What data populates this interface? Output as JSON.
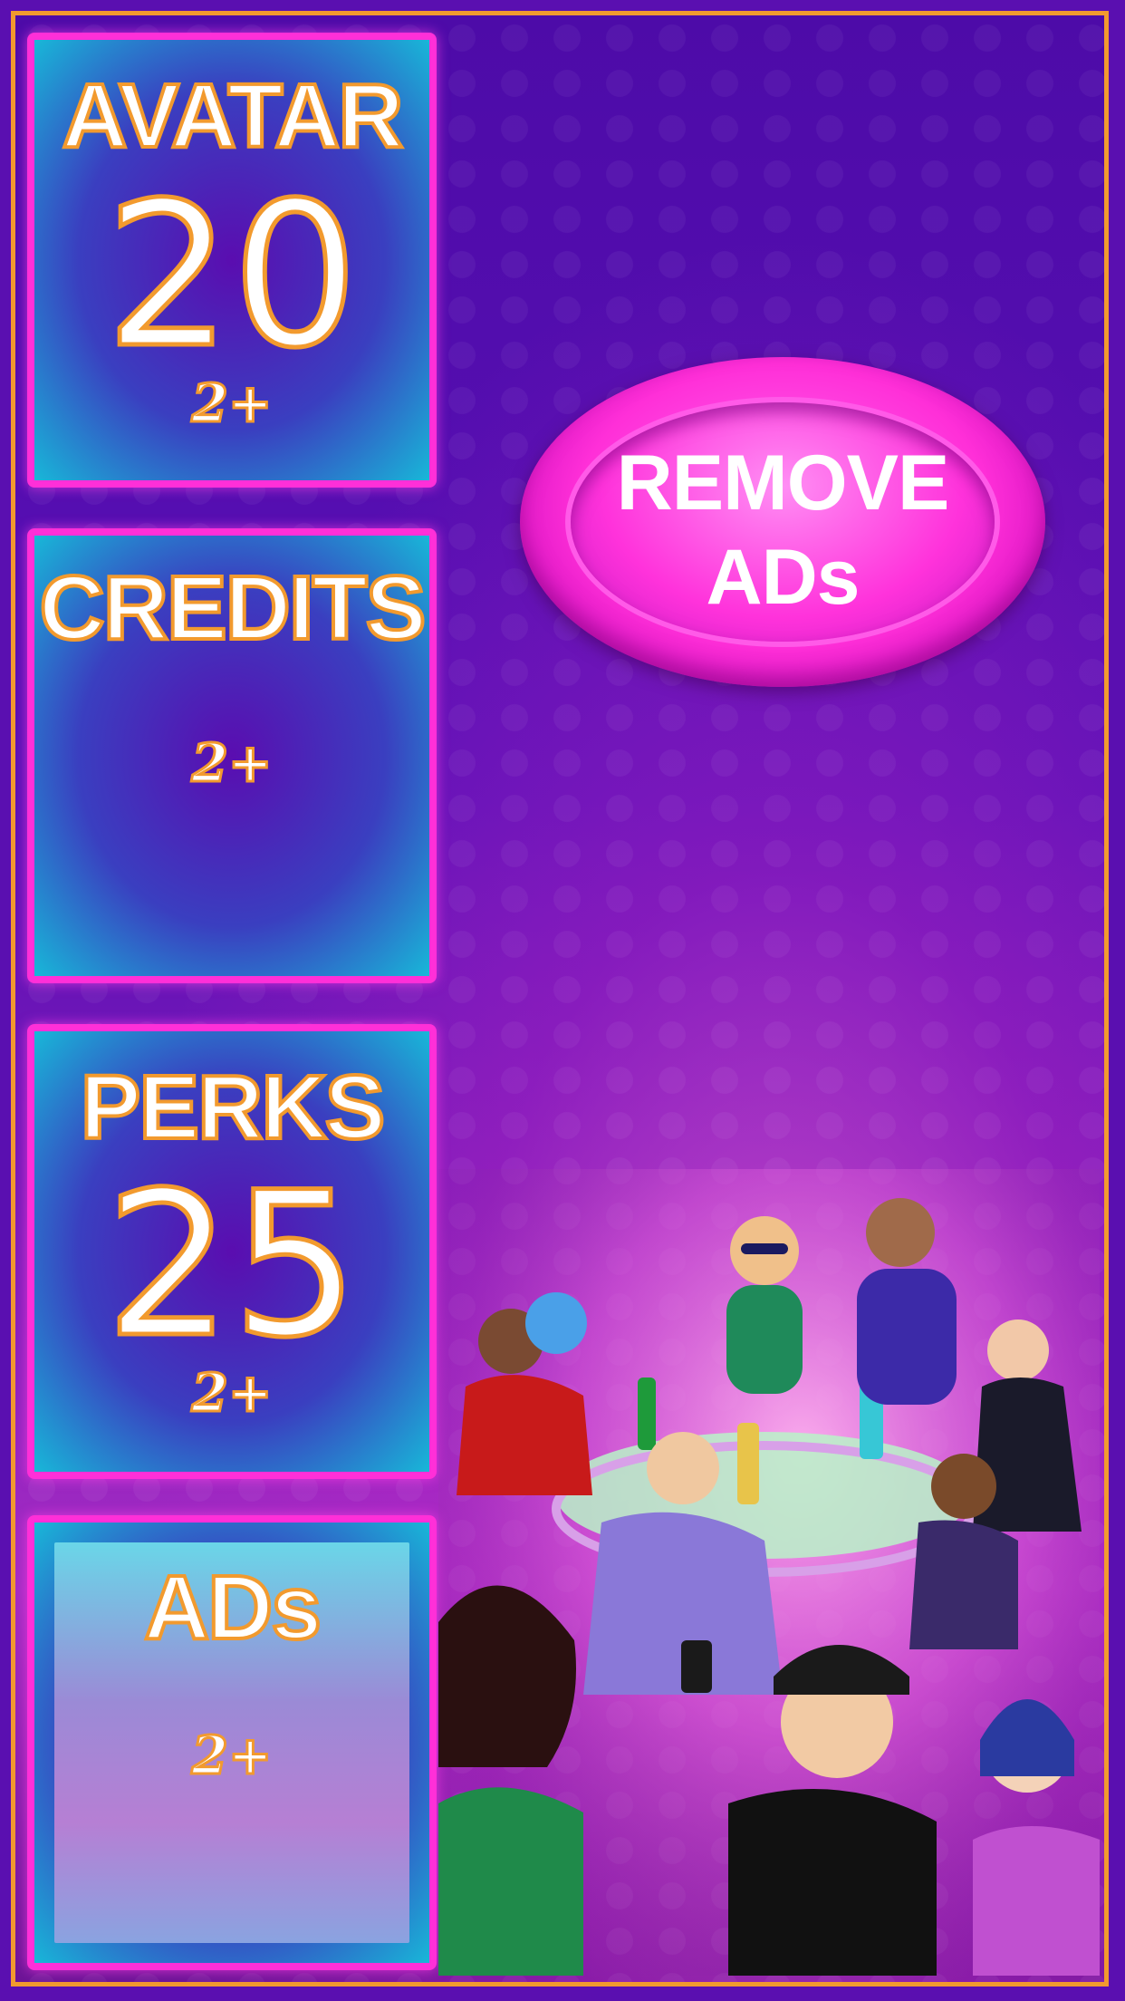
{
  "panels": {
    "avatar": {
      "title": "AVATAR",
      "value": "20",
      "age": "2+"
    },
    "credits": {
      "title": "CREDITS",
      "age": "2+"
    },
    "perks": {
      "title": "PERKS",
      "value": "25",
      "age": "2+"
    },
    "ads": {
      "title": "ADs",
      "age": "2+"
    }
  },
  "remove_ads": {
    "line1": "REMOVE",
    "line2": "ADs"
  },
  "colors": {
    "frame_border": "#f29a2e",
    "panel_border": "#ff2fd8",
    "background": "#5a0fb0",
    "button": "#ff2fd8"
  },
  "illustration": {
    "icon": "party-people-illustration"
  }
}
